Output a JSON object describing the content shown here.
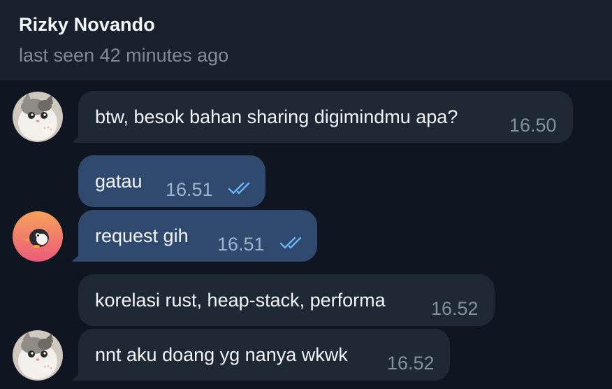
{
  "header": {
    "contact_name": "Rizky Novando",
    "status": "last seen 42 minutes ago"
  },
  "messages": [
    {
      "text": "btw, besok bahan sharing digimindmu apa?",
      "time": "16.50",
      "direction": "incoming"
    },
    {
      "text": "gatau",
      "time": "16.51",
      "direction": "outgoing",
      "read": true
    },
    {
      "text": "request gih",
      "time": "16.51",
      "direction": "outgoing",
      "read": true
    },
    {
      "text": "korelasi rust, heap-stack, performa",
      "time": "16.52",
      "direction": "incoming"
    },
    {
      "text": "nnt aku doang yg nanya wkwk",
      "time": "16.52",
      "direction": "incoming"
    }
  ],
  "avatars": {
    "contact": "cat-avatar",
    "self": "penguin-avatar"
  },
  "colors": {
    "background": "#0f1621",
    "header_bg": "#18212d",
    "incoming_bubble": "#1f2936",
    "outgoing_bubble": "#2f4a6e",
    "read_ticks": "#6ab3f3"
  }
}
